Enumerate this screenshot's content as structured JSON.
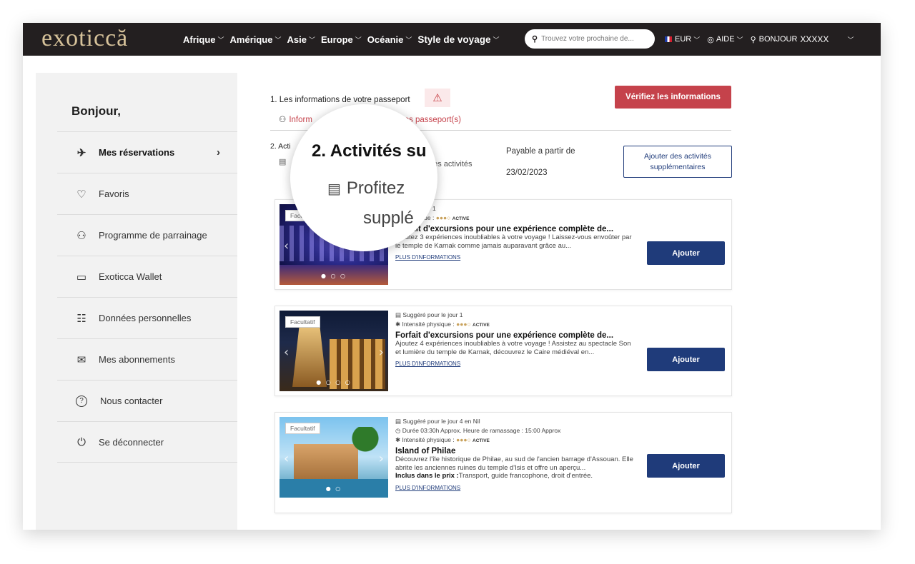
{
  "topbar": {
    "logo": "exoticcă",
    "nav": [
      {
        "label": "Afrique"
      },
      {
        "label": "Amérique"
      },
      {
        "label": "Asie"
      },
      {
        "label": "Europe"
      },
      {
        "label": "Océanie"
      },
      {
        "label": "Style de voyage"
      }
    ],
    "search_placeholder": "Trouvez votre prochaine de...",
    "currency": "EUR",
    "help": "AIDE",
    "greeting": "BONJOUR",
    "username": "XXXXX",
    "bg_color": "#231f20",
    "logo_color": "#d6c29a"
  },
  "sidebar": {
    "hello": "Bonjour,",
    "items": [
      {
        "label": "Mes réservations",
        "icon": "globe-plane-icon",
        "glyph": "✈"
      },
      {
        "label": "Favoris",
        "icon": "heart-icon",
        "glyph": "♡"
      },
      {
        "label": "Programme de parrainage",
        "icon": "add-user-icon",
        "glyph": "⚇"
      },
      {
        "label": "Exoticca Wallet",
        "icon": "wallet-icon",
        "glyph": "▭"
      },
      {
        "label": "Données personnelles",
        "icon": "id-card-icon",
        "glyph": "☷"
      },
      {
        "label": "Mes abonnements",
        "icon": "envelope-icon",
        "glyph": "✉"
      },
      {
        "label": "Nous contacter",
        "icon": "question-icon",
        "glyph": "?"
      },
      {
        "label": "Se déconnecter",
        "icon": "logout-icon",
        "glyph": "⏻"
      }
    ]
  },
  "passport": {
    "title": "1. Les informations de votre passeport",
    "link_start": "Inform",
    "link_end": "otre/vos passeport(s)",
    "verify_button": "Vérifiez les informations"
  },
  "activities": {
    "title": "2. Acti",
    "sub_start": "",
    "sub_end": "des activités",
    "pay_label": "Payable a partir de",
    "pay_date": "23/02/2023",
    "add_button": "Ajouter des activités supplémentaires",
    "magnifier": {
      "title": "2. Activités su",
      "line1": "Profitez",
      "line2": "supplé"
    }
  },
  "cards": [
    {
      "tag": "Facultatif",
      "suggested": "é pour le jour 1",
      "intensity_label": "sité physique :",
      "intensity": "●●●○",
      "active": "ACTIVE",
      "title": "Forfait d'excursions pour une expérience complète de...",
      "desc": "Ajoutez 3 expériences inoubliables à votre voyage ! Laissez-vous envoûter par le temple de Karnak comme jamais auparavant grâce au...",
      "more": "PLUS D'INFORMATIONS",
      "button": "Ajouter"
    },
    {
      "tag": "Facultatif",
      "suggested": "Suggéré pour le jour 1",
      "intensity_label": "Intensité physique :",
      "intensity": "●●●○",
      "active": "ACTIVE",
      "title": "Forfait d'excursions pour une expérience complète de...",
      "desc": "Ajoutez 4 expériences inoubliables à votre voyage ! Assistez au spectacle Son et lumière du temple de Karnak, découvrez le Caire médiéval en...",
      "more": "PLUS D'INFORMATIONS",
      "button": "Ajouter"
    },
    {
      "tag": "Facultatif",
      "suggested": "Suggéré pour le jour 4 en Nil",
      "duration": "Durée 03:30h Approx. Heure de ramassage : 15:00 Approx",
      "intensity_label": "Intensité physique :",
      "intensity": "●●●○",
      "active": "ACTIVE",
      "title": "Island of Philae",
      "desc": "Découvrez l'île historique de Philae, au sud de l'ancien barrage d'Assouan. Elle abrite les anciennes ruines du temple d'Isis et offre un aperçu...",
      "incl_label": "Inclus dans le prix :",
      "incl_value": "Transport, guide francophone, droit d'entrée.",
      "more": "PLUS D'INFORMATIONS",
      "button": "Ajouter"
    }
  ]
}
